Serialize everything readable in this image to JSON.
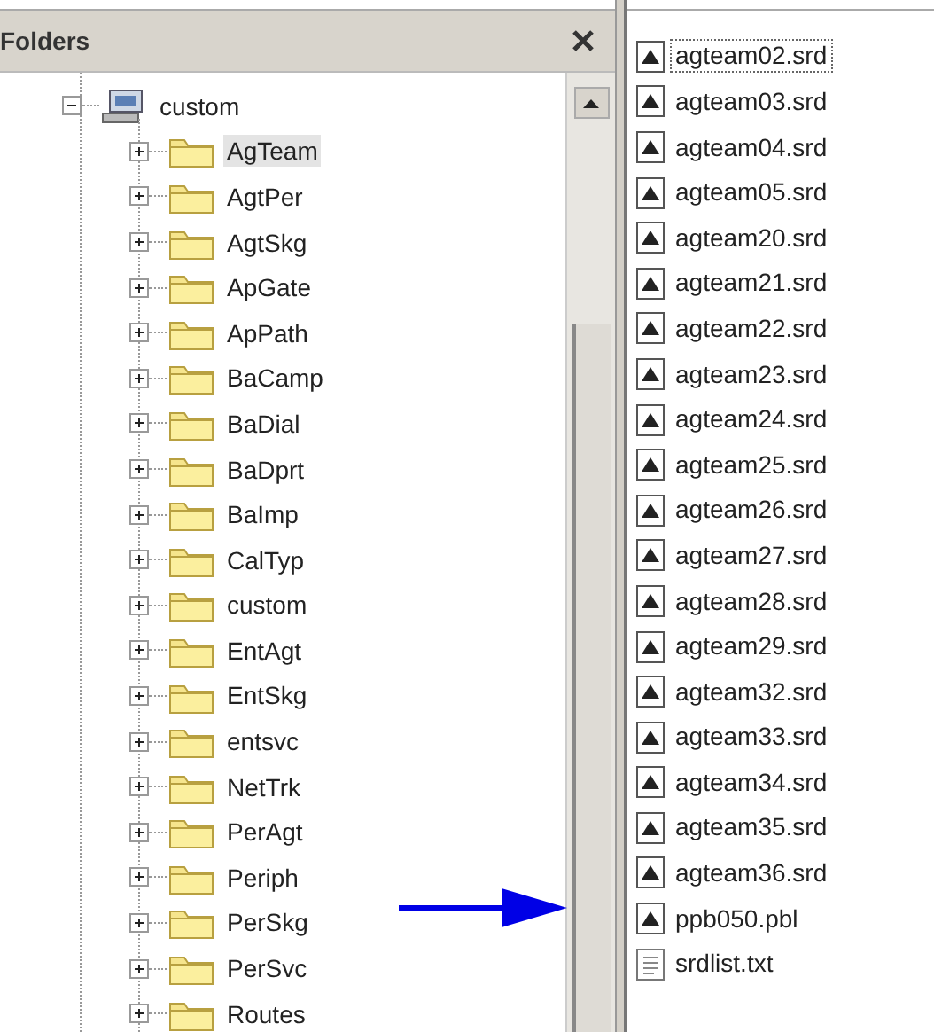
{
  "folders_pane": {
    "title": "Folders",
    "tree": [
      {
        "label": "custom",
        "kind": "computer",
        "expanded": true,
        "selected": false,
        "children": [
          {
            "label": "AgTeam",
            "kind": "folder",
            "expanded": false,
            "selected": true
          },
          {
            "label": "AgtPer",
            "kind": "folder",
            "expanded": false,
            "selected": false
          },
          {
            "label": "AgtSkg",
            "kind": "folder",
            "expanded": false,
            "selected": false
          },
          {
            "label": "ApGate",
            "kind": "folder",
            "expanded": false,
            "selected": false
          },
          {
            "label": "ApPath",
            "kind": "folder",
            "expanded": false,
            "selected": false
          },
          {
            "label": "BaCamp",
            "kind": "folder",
            "expanded": false,
            "selected": false
          },
          {
            "label": "BaDial",
            "kind": "folder",
            "expanded": false,
            "selected": false
          },
          {
            "label": "BaDprt",
            "kind": "folder",
            "expanded": false,
            "selected": false
          },
          {
            "label": "BaImp",
            "kind": "folder",
            "expanded": false,
            "selected": false
          },
          {
            "label": "CalTyp",
            "kind": "folder",
            "expanded": false,
            "selected": false
          },
          {
            "label": "custom",
            "kind": "folder",
            "expanded": false,
            "selected": false
          },
          {
            "label": "EntAgt",
            "kind": "folder",
            "expanded": false,
            "selected": false
          },
          {
            "label": "EntSkg",
            "kind": "folder",
            "expanded": false,
            "selected": false
          },
          {
            "label": "entsvc",
            "kind": "folder",
            "expanded": false,
            "selected": false
          },
          {
            "label": "NetTrk",
            "kind": "folder",
            "expanded": false,
            "selected": false
          },
          {
            "label": "PerAgt",
            "kind": "folder",
            "expanded": false,
            "selected": false
          },
          {
            "label": "Periph",
            "kind": "folder",
            "expanded": false,
            "selected": false
          },
          {
            "label": "PerSkg",
            "kind": "folder",
            "expanded": false,
            "selected": false
          },
          {
            "label": "PerSvc",
            "kind": "folder",
            "expanded": false,
            "selected": false
          },
          {
            "label": "Routes",
            "kind": "folder",
            "expanded": false,
            "selected": false
          }
        ]
      }
    ]
  },
  "files": [
    {
      "name": "agteam02.srd",
      "kind": "library",
      "selected": true
    },
    {
      "name": "agteam03.srd",
      "kind": "library",
      "selected": false
    },
    {
      "name": "agteam04.srd",
      "kind": "library",
      "selected": false
    },
    {
      "name": "agteam05.srd",
      "kind": "library",
      "selected": false
    },
    {
      "name": "agteam20.srd",
      "kind": "library",
      "selected": false
    },
    {
      "name": "agteam21.srd",
      "kind": "library",
      "selected": false
    },
    {
      "name": "agteam22.srd",
      "kind": "library",
      "selected": false
    },
    {
      "name": "agteam23.srd",
      "kind": "library",
      "selected": false
    },
    {
      "name": "agteam24.srd",
      "kind": "library",
      "selected": false
    },
    {
      "name": "agteam25.srd",
      "kind": "library",
      "selected": false
    },
    {
      "name": "agteam26.srd",
      "kind": "library",
      "selected": false
    },
    {
      "name": "agteam27.srd",
      "kind": "library",
      "selected": false
    },
    {
      "name": "agteam28.srd",
      "kind": "library",
      "selected": false
    },
    {
      "name": "agteam29.srd",
      "kind": "library",
      "selected": false
    },
    {
      "name": "agteam32.srd",
      "kind": "library",
      "selected": false
    },
    {
      "name": "agteam33.srd",
      "kind": "library",
      "selected": false
    },
    {
      "name": "agteam34.srd",
      "kind": "library",
      "selected": false
    },
    {
      "name": "agteam35.srd",
      "kind": "library",
      "selected": false
    },
    {
      "name": "agteam36.srd",
      "kind": "library",
      "selected": false
    },
    {
      "name": "ppb050.pbl",
      "kind": "library",
      "selected": false
    },
    {
      "name": "srdlist.txt",
      "kind": "text",
      "selected": false
    }
  ]
}
